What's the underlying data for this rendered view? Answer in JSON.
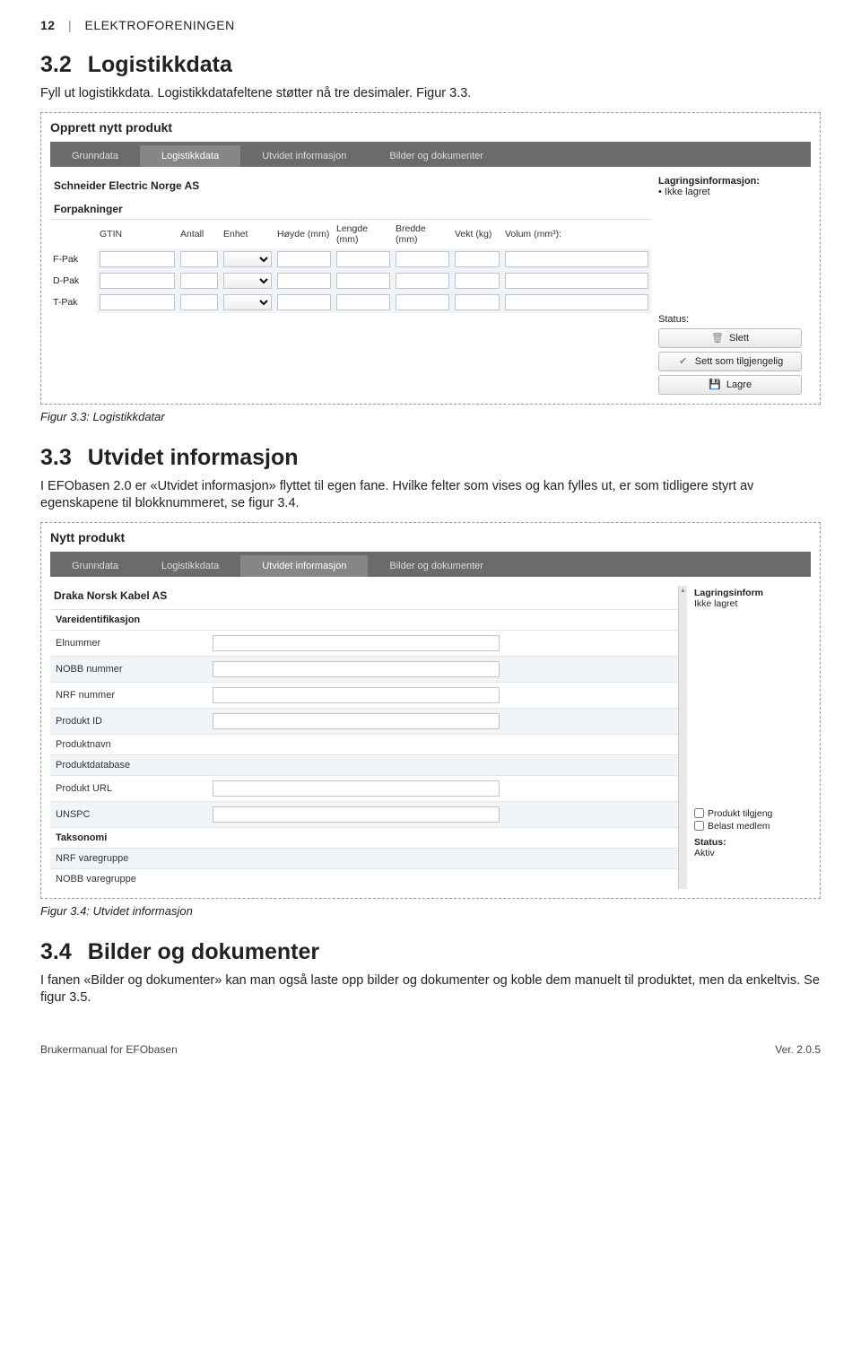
{
  "page": {
    "number": "12",
    "org": "ELEKTROFORENINGEN"
  },
  "s32": {
    "num": "3.2",
    "title": "Logistikkdata",
    "body": "Fyll ut logistikkdata. Logistikkdatafeltene støtter nå tre desimaler. Figur 3.3."
  },
  "fig33": {
    "title": "Opprett nytt produkt",
    "tabs": [
      "Grunndata",
      "Logistikkdata",
      "Utvidet informasjon",
      "Bilder og dokumenter"
    ],
    "active_tab": 1,
    "company": "Schneider Electric Norge AS",
    "subheader": "Forpakninger",
    "cols": [
      "",
      "GTIN",
      "Antall",
      "Enhet",
      "Høyde (mm)",
      "Lengde (mm)",
      "Bredde (mm)",
      "Vekt (kg)",
      "Volum (mm³):"
    ],
    "rows": [
      "F-Pak",
      "D-Pak",
      "T-Pak"
    ],
    "side": {
      "storage_label": "Lagringsinformasjon:",
      "storage_value": "Ikke lagret",
      "status_label": "Status:",
      "buttons": {
        "delete": "Slett",
        "avail": "Sett som tilgjengelig",
        "save": "Lagre"
      }
    },
    "caption": "Figur 3.3: Logistikkdatar"
  },
  "s33": {
    "num": "3.3",
    "title": "Utvidet informasjon",
    "body": "I EFObasen 2.0 er «Utvidet informasjon» flyttet til egen fane. Hvilke felter som vises og kan fylles ut, er som tidligere styrt av egenskapene til blokknummeret, se figur 3.4."
  },
  "fig34": {
    "title": "Nytt produkt",
    "tabs": [
      "Grunndata",
      "Logistikkdata",
      "Utvidet informasjon",
      "Bilder og dokumenter"
    ],
    "active_tab": 2,
    "company": "Draka Norsk Kabel AS",
    "section1": "Vareidentifikasjon",
    "fields": [
      "Elnummer",
      "NOBB nummer",
      "NRF nummer",
      "Produkt ID",
      "Produktnavn",
      "Produktdatabase",
      "Produkt URL",
      "UNSPC"
    ],
    "section2": "Taksonomi",
    "tax_fields": [
      "NRF varegruppe",
      "NOBB varegruppe"
    ],
    "side": {
      "storage_label": "Lagringsinform",
      "storage_value": "Ikke lagret",
      "chk1": "Produkt tilgjeng",
      "chk2": "Belast medlem",
      "status_label": "Status:",
      "status_value": "Aktiv"
    },
    "caption": "Figur 3.4: Utvidet informasjon"
  },
  "s34": {
    "num": "3.4",
    "title": "Bilder og dokumenter",
    "body": "I fanen «Bilder og dokumenter» kan man også laste opp bilder og dokumenter og koble dem manuelt til produktet, men da enkeltvis. Se figur 3.5."
  },
  "footer": {
    "left": "Brukermanual for EFObasen",
    "right": "Ver. 2.0.5"
  }
}
